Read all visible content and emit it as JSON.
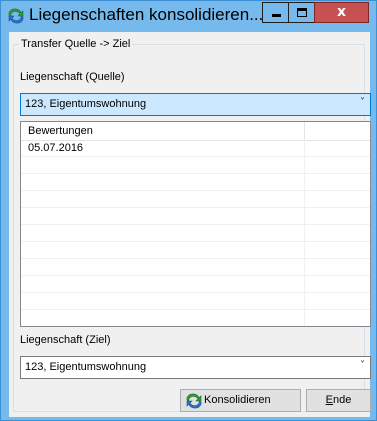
{
  "window": {
    "title": "Liegenschaften konsolidieren...",
    "icon": "refresh-transfer-icon",
    "controls": {
      "minimize_icon": "minimize-icon",
      "maximize_icon": "maximize-icon",
      "close_label": "x"
    }
  },
  "group": {
    "legend": "Transfer Quelle -> Ziel"
  },
  "source": {
    "label": "Liegenschaft (Quelle)",
    "selected": "123, Eigentumswohnung",
    "arrow": "˅"
  },
  "list": {
    "columns": [
      "Bewertungen",
      ""
    ],
    "rows": [
      "05.07.2016",
      "",
      "",
      "",
      "",
      "",
      "",
      "",
      "",
      "",
      ""
    ]
  },
  "target": {
    "label": "Liegenschaft (Ziel)",
    "selected": "123, Eigentumswohnung",
    "arrow": "˅"
  },
  "buttons": {
    "consolidate_label": "Konsolidieren",
    "consolidate_icon": "refresh-transfer-icon",
    "end_label_first": "E",
    "end_label_rest": "nde"
  },
  "colors": {
    "title_bar": "#76b9ed",
    "close_button": "#c75050",
    "active_combo": "#cce8ff",
    "dialog_background": "#f0f0f0"
  }
}
